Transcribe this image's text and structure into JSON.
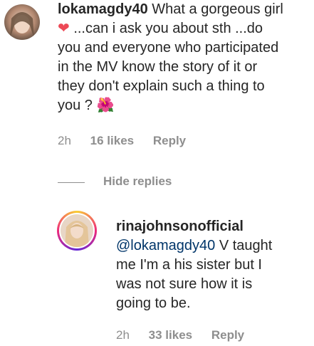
{
  "comment": {
    "username": "lokamagdy40",
    "text_line1": " What a gorgeous girl",
    "text_line2": " ...can i ask you about sth ...do",
    "text_line3": "you and everyone who participated",
    "text_line4": "in the MV know the story of it or",
    "text_line5": "they don't explain such a thing to",
    "text_line6": "you ? ",
    "heart_emoji": "❤",
    "flower_emoji": "🌺",
    "time": "2h",
    "likes": "16 likes",
    "reply": "Reply"
  },
  "hide_replies": "Hide replies",
  "reply_comment": {
    "username": "rinajohnsonofficial",
    "mention": "@lokamagdy40",
    "text_line1_rest": " V taught",
    "text_line2": "me I'm a his sister but I",
    "text_line3": "was not sure how it is",
    "text_line4": "going to be.",
    "time": "2h",
    "likes": "33 likes",
    "reply": "Reply"
  },
  "colors": {
    "text": "#262626",
    "meta": "#8e8e8e",
    "heart": "#ed4956",
    "mention": "#003569"
  }
}
